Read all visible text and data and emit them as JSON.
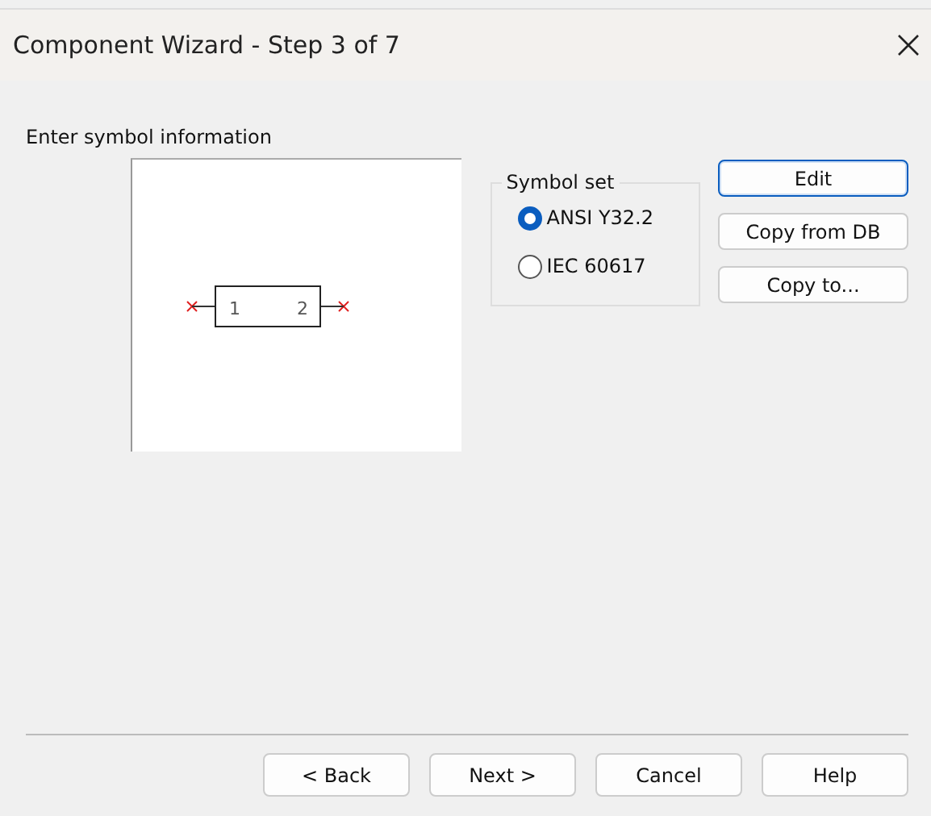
{
  "window": {
    "title": "Component Wizard - Step 3 of 7"
  },
  "prompt": "Enter symbol information",
  "symbol": {
    "pins": [
      "1",
      "2"
    ]
  },
  "symbol_set": {
    "label": "Symbol set",
    "options": [
      {
        "label": "ANSI Y32.2",
        "selected": true
      },
      {
        "label": "IEC 60617",
        "selected": false
      }
    ]
  },
  "side_buttons": [
    {
      "label": "Edit",
      "default": true
    },
    {
      "label": "Copy from DB",
      "default": false
    },
    {
      "label": "Copy to...",
      "default": false
    }
  ],
  "buttons": [
    "< Back",
    "Next >",
    "Cancel",
    "Help"
  ]
}
